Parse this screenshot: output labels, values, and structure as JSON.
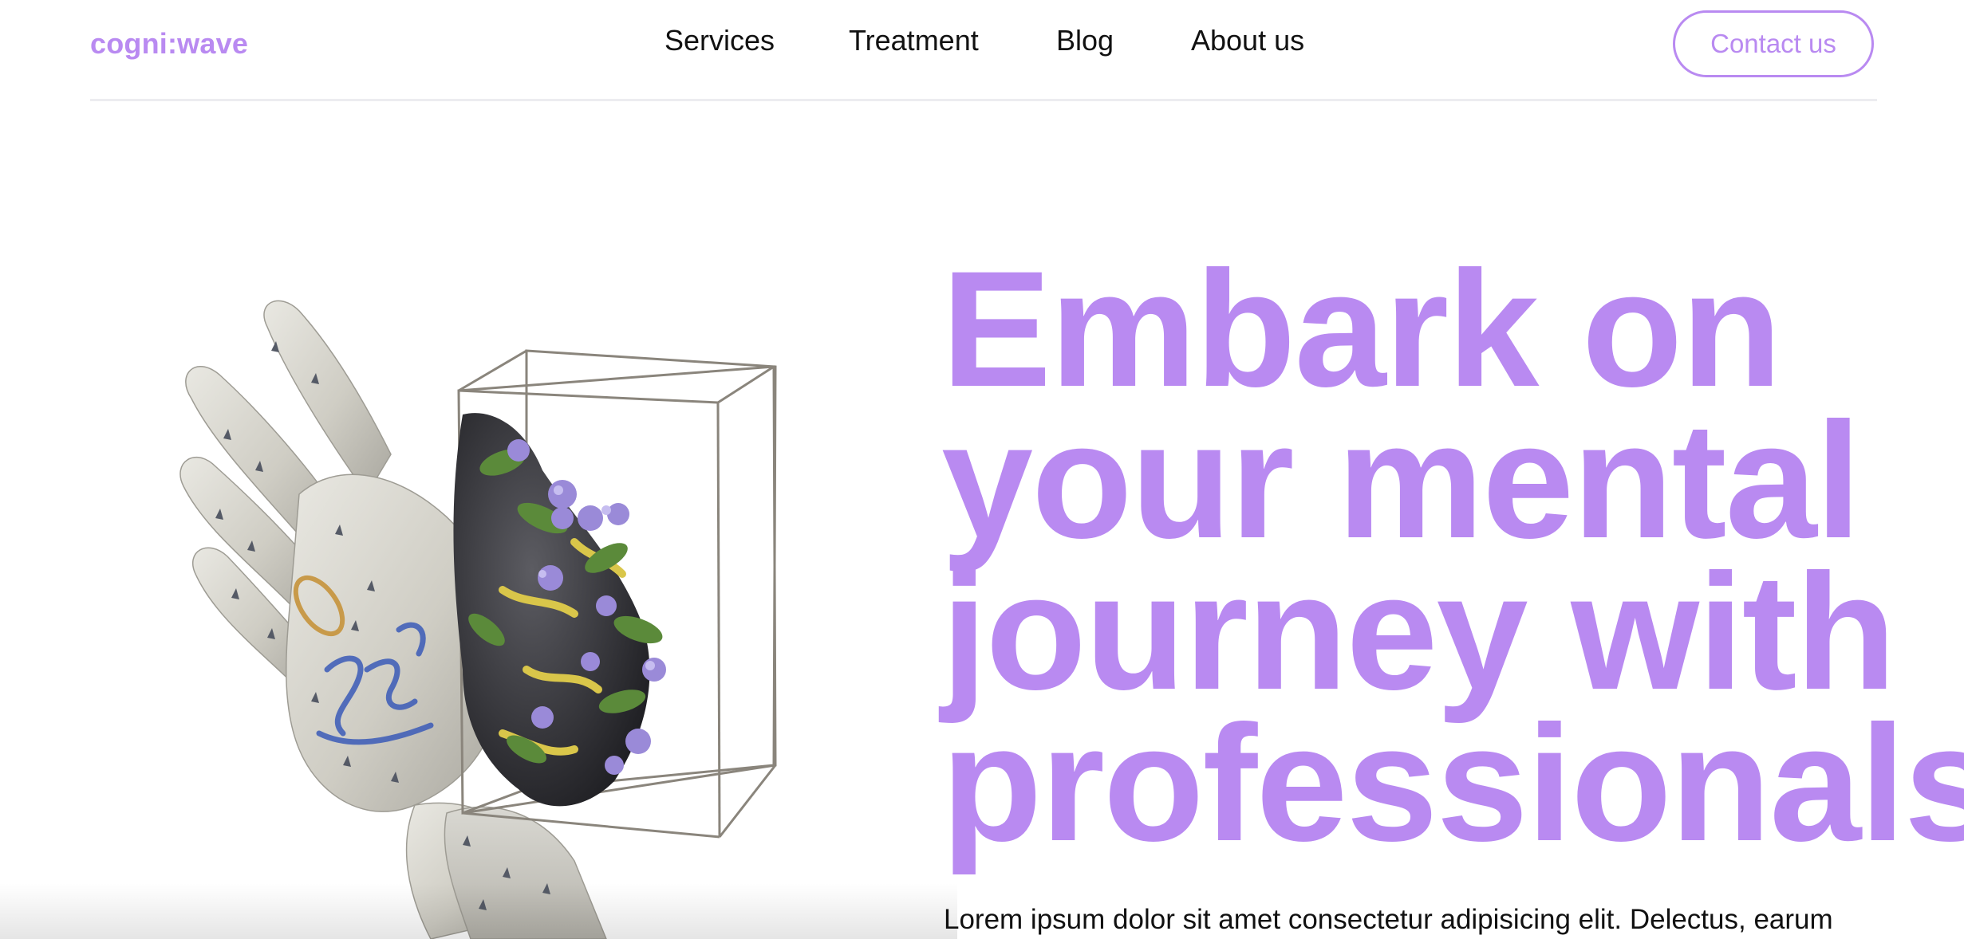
{
  "header": {
    "logo": "cogni:wave",
    "nav": [
      {
        "label": "Services"
      },
      {
        "label": "Treatment"
      },
      {
        "label": "Blog"
      },
      {
        "label": "About us"
      }
    ],
    "contact_label": "Contact us"
  },
  "hero": {
    "title_lines": [
      "Embark on",
      "your mental",
      "journey with",
      "professionals"
    ],
    "body": "Lorem ipsum dolor sit amet consectetur adipisicing elit. Delectus, earum"
  },
  "colors": {
    "accent": "#b98af1",
    "text": "#111111",
    "divider": "#ececf0"
  },
  "images": {
    "hero_art": "3d-hand-with-flowers-in-wire-box"
  }
}
